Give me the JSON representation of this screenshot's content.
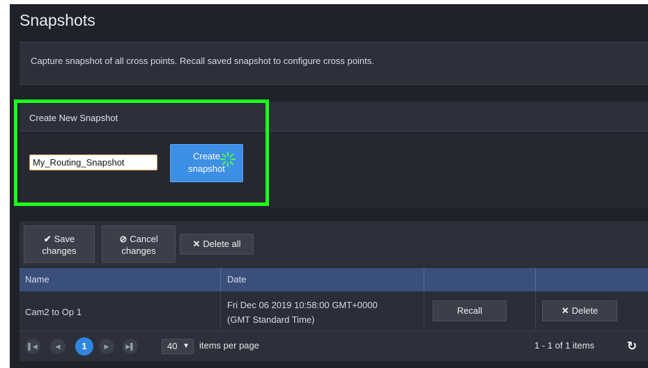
{
  "page": {
    "title": "Snapshots",
    "description": "Capture snapshot of all cross points. Recall saved snapshot to configure cross points."
  },
  "create_panel": {
    "header": "Create New Snapshot",
    "input_value": "My_Routing_Snapshot",
    "create_button_line1": "Create",
    "create_button_line2": "snapshot"
  },
  "toolbar": {
    "save_icon": "✔",
    "save_line1": "Save",
    "save_line2": "changes",
    "cancel_icon": "⊘",
    "cancel_line1": "Cancel",
    "cancel_line2": "changes",
    "delete_all_icon": "✕",
    "delete_all_label": "Delete all"
  },
  "grid": {
    "columns": [
      "Name",
      "Date",
      "",
      ""
    ],
    "rows": [
      {
        "name": "Cam2 to Op 1",
        "date_line1": "Fri Dec 06 2019 10:58:00 GMT+0000",
        "date_line2": "(GMT Standard Time)",
        "recall_label": "Recall",
        "delete_icon": "✕",
        "delete_label": "Delete"
      }
    ]
  },
  "pager": {
    "current_page": "1",
    "page_size": "40",
    "items_per_page_label": "items per page",
    "summary": "1 - 1 of 1 items"
  },
  "icons": {
    "first": "first-page-icon",
    "prev": "prev-page-icon",
    "next": "next-page-icon",
    "last": "last-page-icon",
    "refresh": "refresh-icon",
    "spinner": "loading-spinner-icon"
  },
  "colors": {
    "highlight": "#1eff1e",
    "primary_button": "#3d8fe6",
    "grid_header": "#3a4f7a"
  }
}
